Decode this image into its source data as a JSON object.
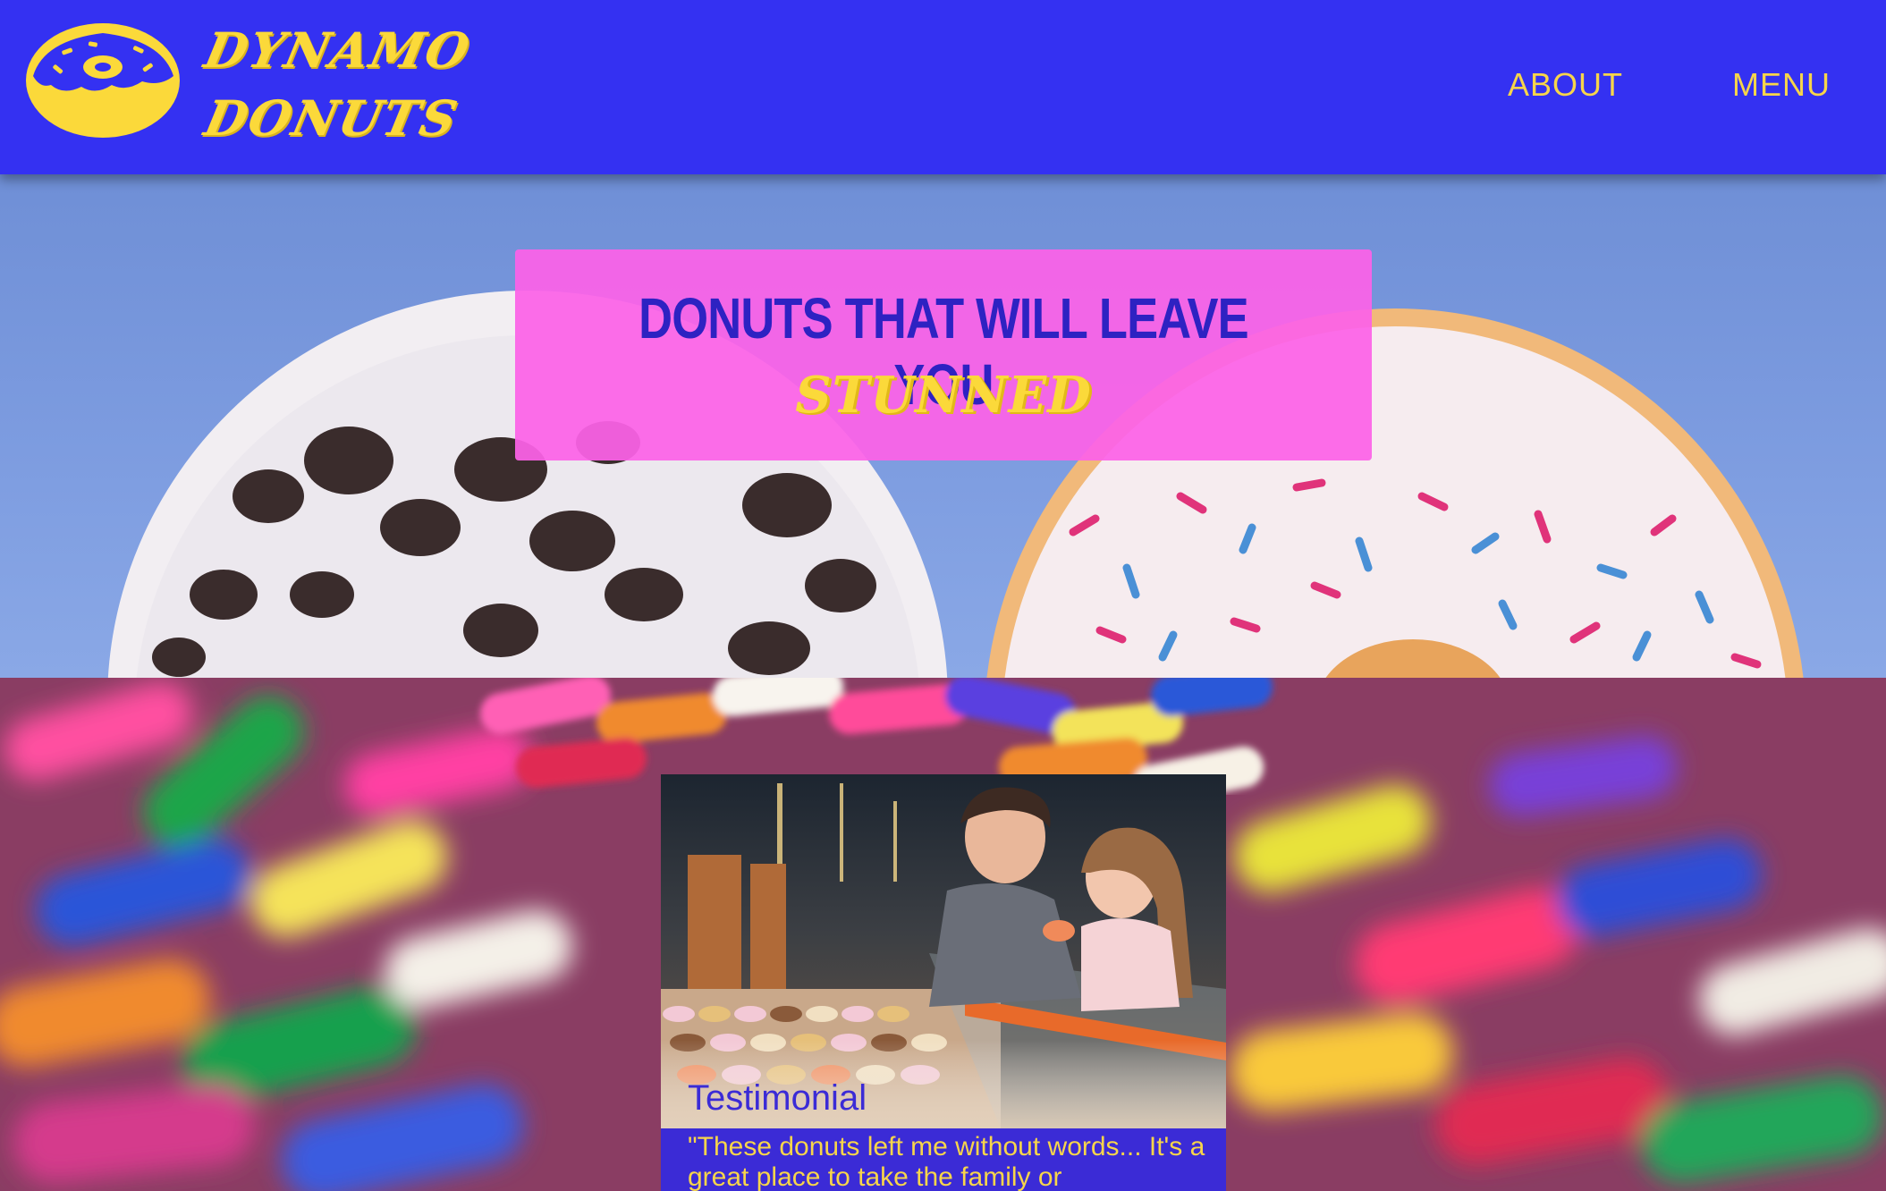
{
  "brand": {
    "name_line1": "DYNAMO",
    "name_line2": "DONUTS",
    "logo_icon": "donut-logo-icon"
  },
  "nav": {
    "items": [
      {
        "label": "ABOUT"
      },
      {
        "label": "MENU"
      }
    ]
  },
  "hero": {
    "title": "DONUTS THAT WILL LEAVE YOU",
    "accent_word": "STUNNED"
  },
  "testimonial": {
    "title": "Testimonial",
    "text": "\"These donuts left me without words... It's a great place to take the family or"
  },
  "colors": {
    "header_bg": "#3431f2",
    "brand_yellow": "#fbd93a",
    "banner_pink": "#fc62e7",
    "title_blue": "#2e22c2"
  }
}
